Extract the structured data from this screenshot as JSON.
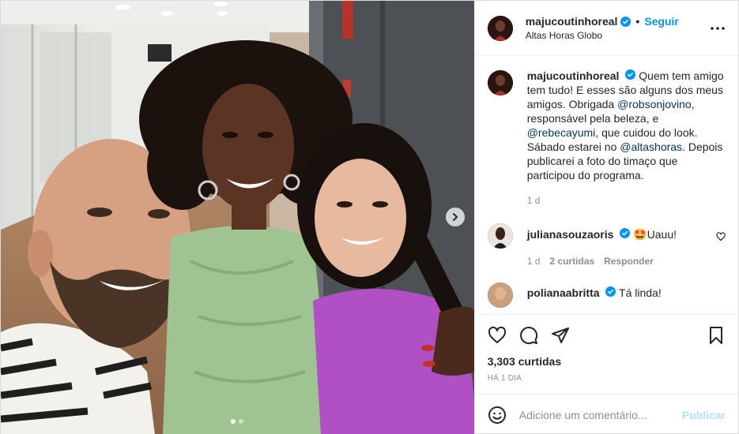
{
  "header": {
    "username": "majucoutinhoreal",
    "separator": "•",
    "follow_label": "Seguir",
    "location": "Altas Horas Globo"
  },
  "caption": {
    "username": "majucoutinhoreal",
    "parts": [
      "Quem tem amigo tem tudo! E esses são alguns dos meus amigos. Obrigada ",
      "@robsonjovino",
      ", responsável pela beleza, e ",
      "@rebecayumi",
      ", que cuidou do look. Sábado estarei no ",
      "@altashoras",
      ". Depois publicarei a foto do timaço que participou do programa."
    ],
    "age": "1 d"
  },
  "comments": [
    {
      "username": "julianasouzaoris",
      "text": "🤩Uauu!",
      "age": "1 d",
      "likes": "2 curtidas",
      "reply_label": "Responder"
    },
    {
      "username": "polianaabritta",
      "text": "Tá linda!"
    }
  ],
  "likes_count": "3,303 curtidas",
  "timestamp": "HÁ 1 DIA",
  "composer": {
    "placeholder": "Adicione um comentário...",
    "publish_label": "Publicar"
  },
  "carousel": {
    "slides": 2,
    "current": 1
  },
  "colors": {
    "accent": "#0095f6",
    "verified": "#0095f6",
    "muted": "#8e8e8e",
    "publish_disabled": "#b2dffc"
  },
  "icons": [
    "verified-badge-icon",
    "more-options-icon",
    "heart-icon",
    "comment-icon",
    "share-icon",
    "save-icon",
    "emoji-icon",
    "chevron-right-icon"
  ]
}
